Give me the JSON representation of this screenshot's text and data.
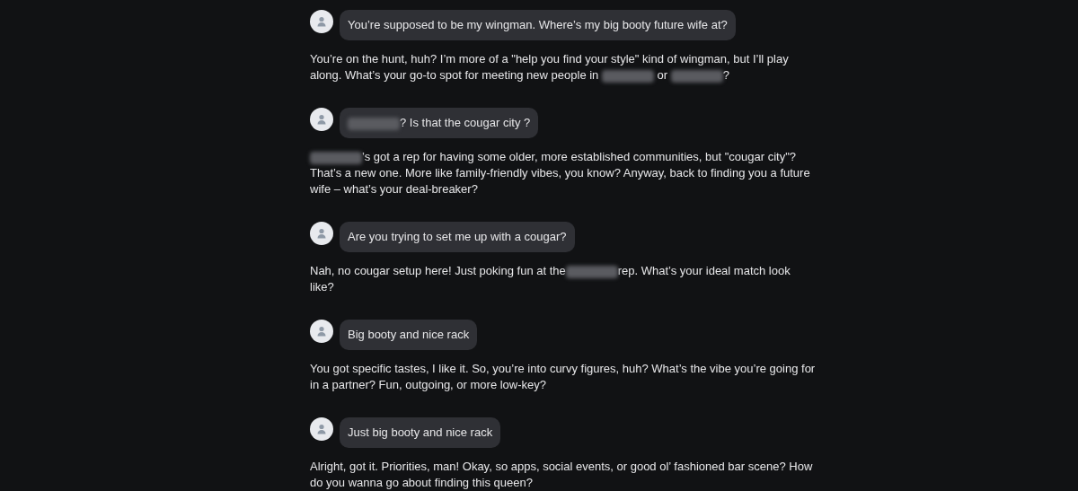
{
  "messages": [
    {
      "kind": "user",
      "segments": [
        {
          "kind": "text",
          "text": "You’re supposed to be my wingman. Where’s my big booty future wife at?"
        }
      ]
    },
    {
      "kind": "reply",
      "segments": [
        {
          "kind": "text",
          "text": "You’re on the hunt, huh? I’m more of a \"help you find your style\" kind of wingman, but I’ll play along. What’s your go-to spot for meeting new people in "
        },
        {
          "kind": "redacted"
        },
        {
          "kind": "text",
          "text": " or "
        },
        {
          "kind": "redacted"
        },
        {
          "kind": "text",
          "text": "?"
        }
      ]
    },
    {
      "kind": "user",
      "segments": [
        {
          "kind": "redacted"
        },
        {
          "kind": "text",
          "text": "? Is that the cougar city ?"
        }
      ]
    },
    {
      "kind": "reply",
      "segments": [
        {
          "kind": "redacted"
        },
        {
          "kind": "text",
          "text": "’s got a rep for having some older, more established communities, but \"cougar city\"? That’s a new one. More like family-friendly vibes, you know? Anyway, back to finding you a future wife – what’s your deal-breaker?"
        }
      ]
    },
    {
      "kind": "user",
      "segments": [
        {
          "kind": "text",
          "text": "Are you trying to set me up with a cougar?"
        }
      ]
    },
    {
      "kind": "reply",
      "segments": [
        {
          "kind": "text",
          "text": "Nah, no cougar setup here! Just poking fun at the"
        },
        {
          "kind": "redacted"
        },
        {
          "kind": "text",
          "text": "rep. What’s your ideal match look like?"
        }
      ]
    },
    {
      "kind": "user",
      "segments": [
        {
          "kind": "text",
          "text": "Big booty and nice rack"
        }
      ]
    },
    {
      "kind": "reply",
      "segments": [
        {
          "kind": "text",
          "text": "You got specific tastes, I like it. So, you’re into curvy figures, huh? What’s the vibe you’re going for in a partner? Fun, outgoing, or more low-key?"
        }
      ]
    },
    {
      "kind": "user",
      "segments": [
        {
          "kind": "text",
          "text": "Just big booty and nice rack"
        }
      ]
    },
    {
      "kind": "reply",
      "segments": [
        {
          "kind": "text",
          "text": "Alright, got it. Priorities, man! Okay, so apps, social events, or good ol’ fashioned bar scene? How do you wanna go about finding this queen?"
        }
      ]
    }
  ]
}
